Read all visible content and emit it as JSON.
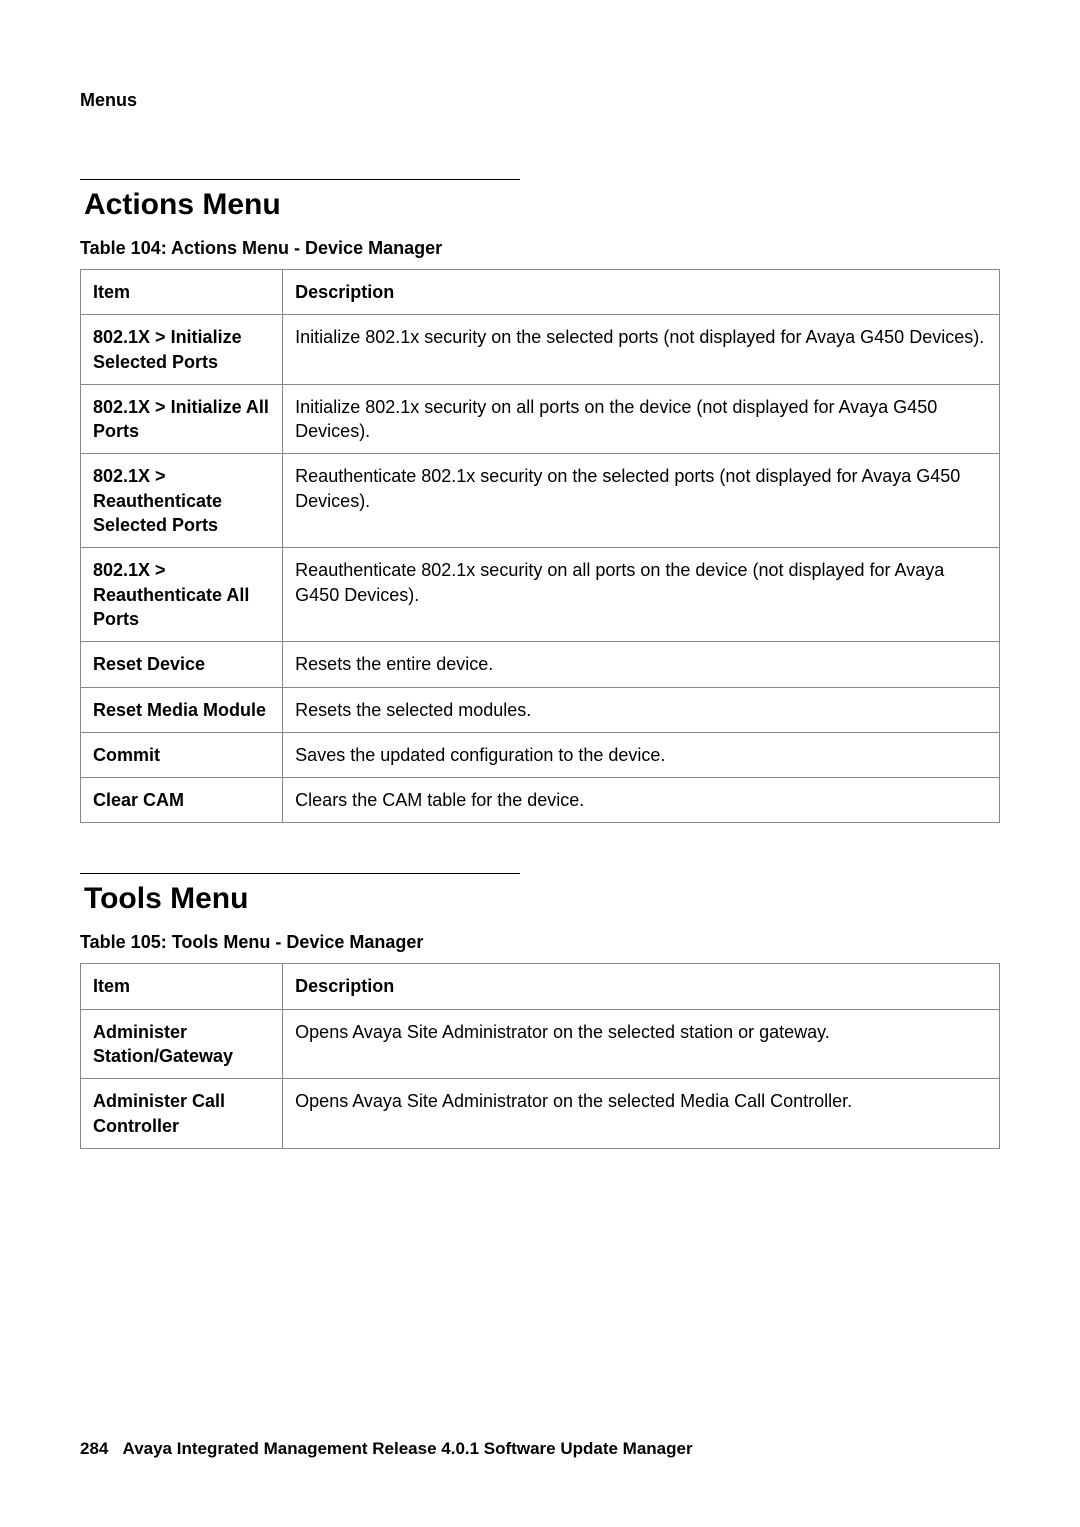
{
  "header": {
    "label": "Menus"
  },
  "section1": {
    "title": "Actions Menu",
    "tableCaption": "Table 104: Actions Menu - Device Manager",
    "columns": {
      "item": "Item",
      "description": "Description"
    },
    "rows": [
      {
        "item": "802.1X > Initialize Selected Ports",
        "description": "Initialize 802.1x security on the selected ports (not displayed for Avaya G450 Devices)."
      },
      {
        "item": "802.1X > Initialize All Ports",
        "description": "Initialize 802.1x security on all ports on the device (not displayed for Avaya G450 Devices)."
      },
      {
        "item": "802.1X > Reauthenticate Selected Ports",
        "description": "Reauthenticate 802.1x security on the selected ports (not displayed for Avaya G450 Devices)."
      },
      {
        "item": "802.1X > Reauthenticate All Ports",
        "description": "Reauthenticate 802.1x security on all ports on the device (not displayed for Avaya G450 Devices)."
      },
      {
        "item": "Reset Device",
        "description": "Resets the entire device."
      },
      {
        "item": "Reset Media Module",
        "description": "Resets the selected modules."
      },
      {
        "item": "Commit",
        "description": "Saves the updated configuration to the device."
      },
      {
        "item": "Clear CAM",
        "description": "Clears the CAM table for the device."
      }
    ]
  },
  "section2": {
    "title": "Tools Menu",
    "tableCaption": "Table 105: Tools Menu - Device Manager",
    "columns": {
      "item": "Item",
      "description": "Description"
    },
    "rows": [
      {
        "item": "Administer Station/Gateway",
        "description": "Opens Avaya Site Administrator on the selected station or gateway."
      },
      {
        "item": "Administer Call Controller",
        "description": "Opens Avaya Site Administrator on the selected Media Call Controller."
      }
    ]
  },
  "footer": {
    "pageNumber": "284",
    "text": "Avaya Integrated Management Release 4.0.1 Software Update Manager"
  }
}
